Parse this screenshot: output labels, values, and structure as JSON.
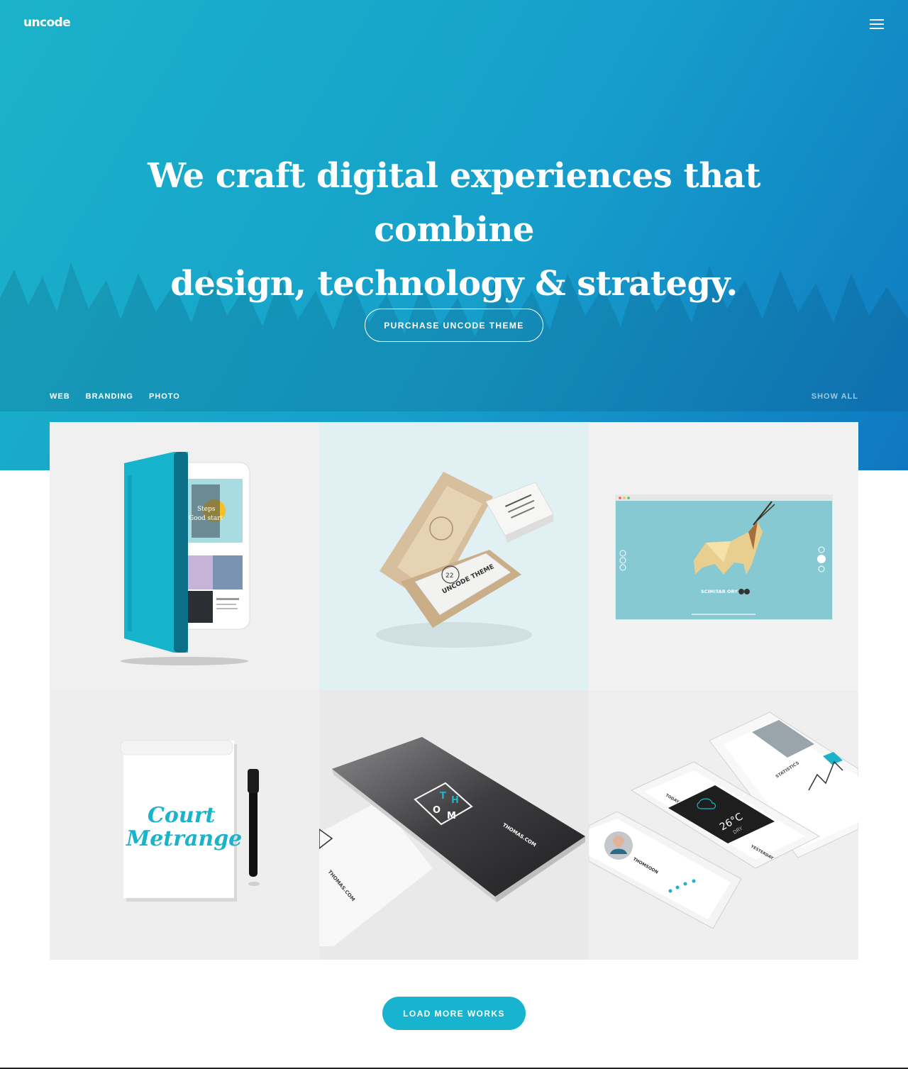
{
  "header": {
    "logo_text": "uncode",
    "menu_icon": "hamburger-menu-icon"
  },
  "hero": {
    "headline_line1": "We craft digital experiences that combine",
    "headline_line2": "design, technology & strategy.",
    "cta_label": "PURCHASE UNCODE THEME",
    "gradient_colors": [
      "#1bb3c9",
      "#169fcb",
      "#0f78c0"
    ]
  },
  "filters": {
    "items": [
      {
        "label": "WEB"
      },
      {
        "label": "BRANDING"
      },
      {
        "label": "PHOTO"
      }
    ],
    "show_all_label": "SHOW ALL"
  },
  "portfolio": {
    "items": [
      {
        "name": "tablet-mockup",
        "title": "tablet-mockup",
        "texts": [
          "Steps",
          "Good start"
        ]
      },
      {
        "name": "business-cards-box",
        "title": "business-cards-box",
        "texts": [
          "UNCODE THEME",
          "22"
        ]
      },
      {
        "name": "browser-oryx",
        "title": "browser-oryx",
        "texts": [
          "SCIMITAR ORYX"
        ]
      },
      {
        "name": "notepad-lettering",
        "title": "notepad-lettering",
        "texts": [
          "Court",
          "Metrange"
        ]
      },
      {
        "name": "thomas-cards",
        "title": "thomas-cards",
        "texts": [
          "T",
          "H",
          "O",
          "M",
          "THOMAS.COM",
          "THOMAS.COM"
        ]
      },
      {
        "name": "phone-app-screens",
        "title": "phone-app-screens",
        "texts": [
          "THOMSOON",
          "TODAY",
          "26°C",
          "DRY",
          "YESTERDAY",
          "STATISTICS"
        ]
      }
    ]
  },
  "load_more": {
    "label": "LOAD MORE WORKS",
    "color": "#17b3cf"
  }
}
